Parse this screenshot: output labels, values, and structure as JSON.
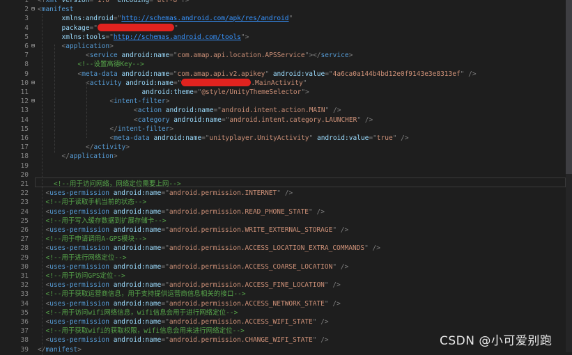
{
  "editor": {
    "lines": [
      {
        "n": "1",
        "indent": 0,
        "tokens": [
          [
            "p",
            "<?"
          ],
          [
            "tag",
            "xml"
          ],
          [
            "attr",
            " version"
          ],
          [
            "p",
            "="
          ],
          [
            "str",
            "\"1.0\""
          ],
          [
            "attr",
            " encoding"
          ],
          [
            "p",
            "="
          ],
          [
            "str",
            "\"utf-8\""
          ],
          [
            "p",
            "?>"
          ]
        ]
      },
      {
        "n": "2",
        "indent": 0,
        "tokens": [
          [
            "p",
            "<"
          ],
          [
            "tag",
            "manifest"
          ]
        ]
      },
      {
        "n": "3",
        "indent": 3,
        "tokens": [
          [
            "attr",
            "xmlns:android"
          ],
          [
            "p",
            "=\""
          ],
          [
            "url",
            "http://schemas.android.com/apk/res/android"
          ],
          [
            "p",
            "\""
          ]
        ]
      },
      {
        "n": "4",
        "indent": 3,
        "tokens": [
          [
            "attr",
            "package"
          ],
          [
            "p",
            "=\""
          ],
          [
            "redact",
            "110"
          ],
          [
            "p",
            "\""
          ]
        ]
      },
      {
        "n": "5",
        "indent": 3,
        "tokens": [
          [
            "attr",
            "xmlns:tools"
          ],
          [
            "p",
            "=\""
          ],
          [
            "url",
            "http://schemas.android.com/tools"
          ],
          [
            "p",
            "\">"
          ]
        ]
      },
      {
        "n": "6",
        "indent": 3,
        "tokens": [
          [
            "p",
            "<"
          ],
          [
            "tag",
            "application"
          ],
          [
            "p",
            ">"
          ]
        ]
      },
      {
        "n": "7",
        "indent": 6,
        "tokens": [
          [
            "p",
            "<"
          ],
          [
            "tag",
            "service"
          ],
          [
            "attr",
            " android:name"
          ],
          [
            "p",
            "=\""
          ],
          [
            "str",
            "com.amap.api.location.APSService"
          ],
          [
            "p",
            "\"></"
          ],
          [
            "tag",
            "service"
          ],
          [
            "p",
            ">"
          ]
        ]
      },
      {
        "n": "8",
        "indent": 5,
        "tokens": [
          [
            "com",
            "<!--设置高德Key-->"
          ]
        ]
      },
      {
        "n": "9",
        "indent": 5,
        "tokens": [
          [
            "p",
            "<"
          ],
          [
            "tag",
            "meta-data"
          ],
          [
            "attr",
            " android:name"
          ],
          [
            "p",
            "=\""
          ],
          [
            "str",
            "com.amap.api.v2.apikey"
          ],
          [
            "p",
            "\""
          ],
          [
            "attr",
            " android:value"
          ],
          [
            "p",
            "=\""
          ],
          [
            "str",
            "4a6ca0a144b4bd12e0f9143e3e8313ef"
          ],
          [
            "p",
            "\" />"
          ]
        ]
      },
      {
        "n": "10",
        "indent": 6,
        "tokens": [
          [
            "p",
            "<"
          ],
          [
            "tag",
            "activity"
          ],
          [
            "attr",
            " android:name"
          ],
          [
            "p",
            "=\""
          ],
          [
            "redact",
            "100"
          ],
          [
            "str",
            ".MainActivity"
          ],
          [
            "p",
            "\""
          ]
        ]
      },
      {
        "n": "11",
        "indent": 13,
        "tokens": [
          [
            "attr",
            "android:theme"
          ],
          [
            "p",
            "=\""
          ],
          [
            "str",
            "@style/UnityThemeSelector"
          ],
          [
            "p",
            "\">"
          ]
        ]
      },
      {
        "n": "12",
        "indent": 9,
        "tokens": [
          [
            "p",
            "<"
          ],
          [
            "tag",
            "intent-filter"
          ],
          [
            "p",
            ">"
          ]
        ]
      },
      {
        "n": "13",
        "indent": 12,
        "tokens": [
          [
            "p",
            "<"
          ],
          [
            "tag",
            "action"
          ],
          [
            "attr",
            " android:name"
          ],
          [
            "p",
            "=\""
          ],
          [
            "str",
            "android.intent.action.MAIN"
          ],
          [
            "p",
            "\" />"
          ]
        ]
      },
      {
        "n": "14",
        "indent": 12,
        "tokens": [
          [
            "p",
            "<"
          ],
          [
            "tag",
            "category"
          ],
          [
            "attr",
            " android:name"
          ],
          [
            "p",
            "=\""
          ],
          [
            "str",
            "android.intent.category.LAUNCHER"
          ],
          [
            "p",
            "\" />"
          ]
        ]
      },
      {
        "n": "15",
        "indent": 9,
        "tokens": [
          [
            "p",
            "</"
          ],
          [
            "tag",
            "intent-filter"
          ],
          [
            "p",
            ">"
          ]
        ]
      },
      {
        "n": "16",
        "indent": 9,
        "tokens": [
          [
            "p",
            "<"
          ],
          [
            "tag",
            "meta-data"
          ],
          [
            "attr",
            " android:name"
          ],
          [
            "p",
            "=\""
          ],
          [
            "str",
            "unityplayer.UnityActivity"
          ],
          [
            "p",
            "\""
          ],
          [
            "attr",
            " android:value"
          ],
          [
            "p",
            "=\""
          ],
          [
            "str",
            "true"
          ],
          [
            "p",
            "\" />"
          ]
        ]
      },
      {
        "n": "17",
        "indent": 6,
        "tokens": [
          [
            "p",
            "</"
          ],
          [
            "tag",
            "activity"
          ],
          [
            "p",
            ">"
          ]
        ]
      },
      {
        "n": "18",
        "indent": 3,
        "tokens": [
          [
            "p",
            "</"
          ],
          [
            "tag",
            "application"
          ],
          [
            "p",
            ">"
          ]
        ]
      },
      {
        "n": "19",
        "indent": 0,
        "tokens": []
      },
      {
        "n": "20",
        "indent": 0,
        "tokens": []
      },
      {
        "n": "21",
        "indent": 2,
        "tokens": [
          [
            "com",
            "<!--用于访问网络，网络定位需要上网-->"
          ]
        ]
      },
      {
        "n": "22",
        "indent": 1,
        "tokens": [
          [
            "p",
            "<"
          ],
          [
            "tag",
            "uses-permission"
          ],
          [
            "attr",
            " android:name"
          ],
          [
            "p",
            "=\""
          ],
          [
            "str",
            "android.permission.INTERNET"
          ],
          [
            "p",
            "\" />"
          ]
        ]
      },
      {
        "n": "23",
        "indent": 1,
        "tokens": [
          [
            "com",
            "<!--用于读取手机当前的状态-->"
          ]
        ]
      },
      {
        "n": "24",
        "indent": 1,
        "tokens": [
          [
            "p",
            "<"
          ],
          [
            "tag",
            "uses-permission"
          ],
          [
            "attr",
            " android:name"
          ],
          [
            "p",
            "=\""
          ],
          [
            "str",
            "android.permission.READ_PHONE_STATE"
          ],
          [
            "p",
            "\" />"
          ]
        ]
      },
      {
        "n": "25",
        "indent": 1,
        "tokens": [
          [
            "com",
            "<!--用于写入缓存数据到扩展存储卡-->"
          ]
        ]
      },
      {
        "n": "26",
        "indent": 1,
        "tokens": [
          [
            "p",
            "<"
          ],
          [
            "tag",
            "uses-permission"
          ],
          [
            "attr",
            " android:name"
          ],
          [
            "p",
            "=\""
          ],
          [
            "str",
            "android.permission.WRITE_EXTERNAL_STORAGE"
          ],
          [
            "p",
            "\" />"
          ]
        ]
      },
      {
        "n": "27",
        "indent": 1,
        "tokens": [
          [
            "com",
            "<!--用于申请调用A-GPS模块-->"
          ]
        ]
      },
      {
        "n": "28",
        "indent": 1,
        "tokens": [
          [
            "p",
            "<"
          ],
          [
            "tag",
            "uses-permission"
          ],
          [
            "attr",
            " android:name"
          ],
          [
            "p",
            "=\""
          ],
          [
            "str",
            "android.permission.ACCESS_LOCATION_EXTRA_COMMANDS"
          ],
          [
            "p",
            "\" />"
          ]
        ]
      },
      {
        "n": "29",
        "indent": 1,
        "tokens": [
          [
            "com",
            "<!--用于进行网络定位-->"
          ]
        ]
      },
      {
        "n": "30",
        "indent": 1,
        "tokens": [
          [
            "p",
            "<"
          ],
          [
            "tag",
            "uses-permission"
          ],
          [
            "attr",
            " android:name"
          ],
          [
            "p",
            "=\""
          ],
          [
            "str",
            "android.permission.ACCESS_COARSE_LOCATION"
          ],
          [
            "p",
            "\" />"
          ]
        ]
      },
      {
        "n": "31",
        "indent": 1,
        "tokens": [
          [
            "com",
            "<!--用于访问GPS定位-->"
          ]
        ]
      },
      {
        "n": "32",
        "indent": 1,
        "tokens": [
          [
            "p",
            "<"
          ],
          [
            "tag",
            "uses-permission"
          ],
          [
            "attr",
            " android:name"
          ],
          [
            "p",
            "=\""
          ],
          [
            "str",
            "android.permission.ACCESS_FINE_LOCATION"
          ],
          [
            "p",
            "\" />"
          ]
        ]
      },
      {
        "n": "33",
        "indent": 1,
        "tokens": [
          [
            "com",
            "<!--用于获取运营商信息，用于支持提供运营商信息相关的接口-->"
          ]
        ]
      },
      {
        "n": "34",
        "indent": 1,
        "tokens": [
          [
            "p",
            "<"
          ],
          [
            "tag",
            "uses-permission"
          ],
          [
            "attr",
            " android:name"
          ],
          [
            "p",
            "=\""
          ],
          [
            "str",
            "android.permission.ACCESS_NETWORK_STATE"
          ],
          [
            "p",
            "\" />"
          ]
        ]
      },
      {
        "n": "35",
        "indent": 1,
        "tokens": [
          [
            "com",
            "<!--用于访问wifi网络信息，wifi信息会用于进行网络定位-->"
          ]
        ]
      },
      {
        "n": "36",
        "indent": 1,
        "tokens": [
          [
            "p",
            "<"
          ],
          [
            "tag",
            "uses-permission"
          ],
          [
            "attr",
            " android:name"
          ],
          [
            "p",
            "=\""
          ],
          [
            "str",
            "android.permission.ACCESS_WIFI_STATE"
          ],
          [
            "p",
            "\" />"
          ]
        ]
      },
      {
        "n": "37",
        "indent": 1,
        "tokens": [
          [
            "com",
            "<!--用于获取wifi的获取权限，wifi信息会用来进行网络定位-->"
          ]
        ]
      },
      {
        "n": "38",
        "indent": 1,
        "tokens": [
          [
            "p",
            "<"
          ],
          [
            "tag",
            "uses-permission"
          ],
          [
            "attr",
            " android:name"
          ],
          [
            "p",
            "=\""
          ],
          [
            "str",
            "android.permission.CHANGE_WIFI_STATE"
          ],
          [
            "p",
            "\" />"
          ]
        ]
      },
      {
        "n": "39",
        "indent": 0,
        "tokens": [
          [
            "p",
            "</"
          ],
          [
            "tag",
            "manifest"
          ],
          [
            "p",
            ">"
          ]
        ]
      }
    ],
    "fold_markers": {
      "2": "⊟",
      "6": "⊟",
      "10": "⊟",
      "12": "⊟"
    }
  },
  "watermark": "CSDN @小可爱别跑",
  "colors": {
    "background": "#1e1e1e",
    "tag": "#569cd6",
    "attribute": "#9cdcfe",
    "string": "#ce9178",
    "comment": "#57a64a",
    "redaction": "#e1231f"
  }
}
